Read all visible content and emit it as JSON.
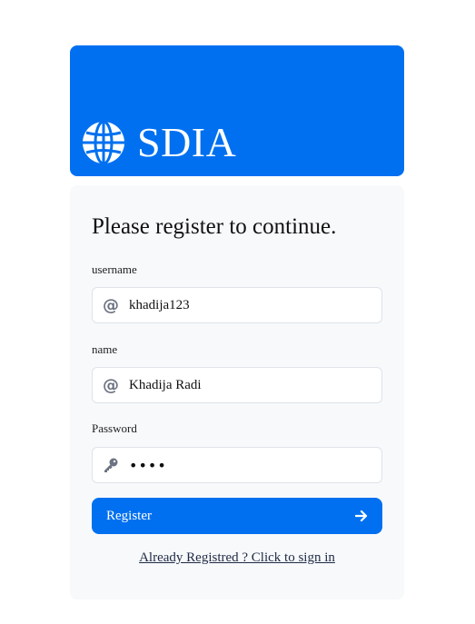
{
  "brand": {
    "name": "SDIA",
    "logo_icon": "globe-icon"
  },
  "form": {
    "heading": "Please register to continue.",
    "username": {
      "label": "username",
      "icon": "at-icon",
      "value": "khadija123"
    },
    "name": {
      "label": "name",
      "icon": "at-icon",
      "value": "Khadija Radi"
    },
    "password": {
      "label": "Password",
      "icon": "key-icon",
      "value": "••••"
    },
    "submit": {
      "label": "Register",
      "icon": "arrow-right-icon"
    },
    "signin_link": "Already Registred ? Click to sign in"
  },
  "colors": {
    "accent": "#0070f0",
    "card_bg": "#f7f9fb",
    "icon": "#6b7280"
  }
}
